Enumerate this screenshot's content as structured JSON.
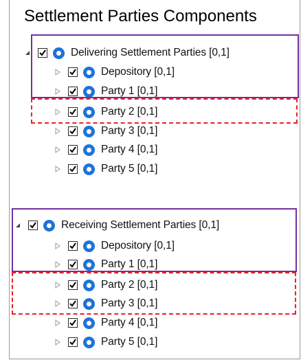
{
  "title": "Settlement Parties Components",
  "delivering": {
    "header": "Delivering Settlement Parties [0,1]",
    "items": [
      {
        "label": "Depository [0,1]"
      },
      {
        "label": "Party 1 [0,1]"
      },
      {
        "label": "Party 2 [0,1]"
      },
      {
        "label": "Party 3 [0,1]"
      },
      {
        "label": "Party 4 [0,1]"
      },
      {
        "label": "Party 5 [0,1]"
      }
    ]
  },
  "receiving": {
    "header": "Receiving Settlement Parties [0,1]",
    "items": [
      {
        "label": "Depository [0,1]"
      },
      {
        "label": "Party 1 [0,1]"
      },
      {
        "label": "Party 2 [0,1]"
      },
      {
        "label": "Party 3 [0,1]"
      },
      {
        "label": "Party 4 [0,1]"
      },
      {
        "label": "Party 5 [0,1]"
      }
    ]
  },
  "colors": {
    "solid_box": "#7030A0",
    "dashed_box": "#E8202A",
    "node_icon": "#1E73D8"
  },
  "icons": {
    "expander_collapsed": "triangle-right-icon",
    "expander_expanded": "triangle-down-icon",
    "checkbox": "checkbox-checked-icon",
    "node": "ring-node-icon"
  }
}
